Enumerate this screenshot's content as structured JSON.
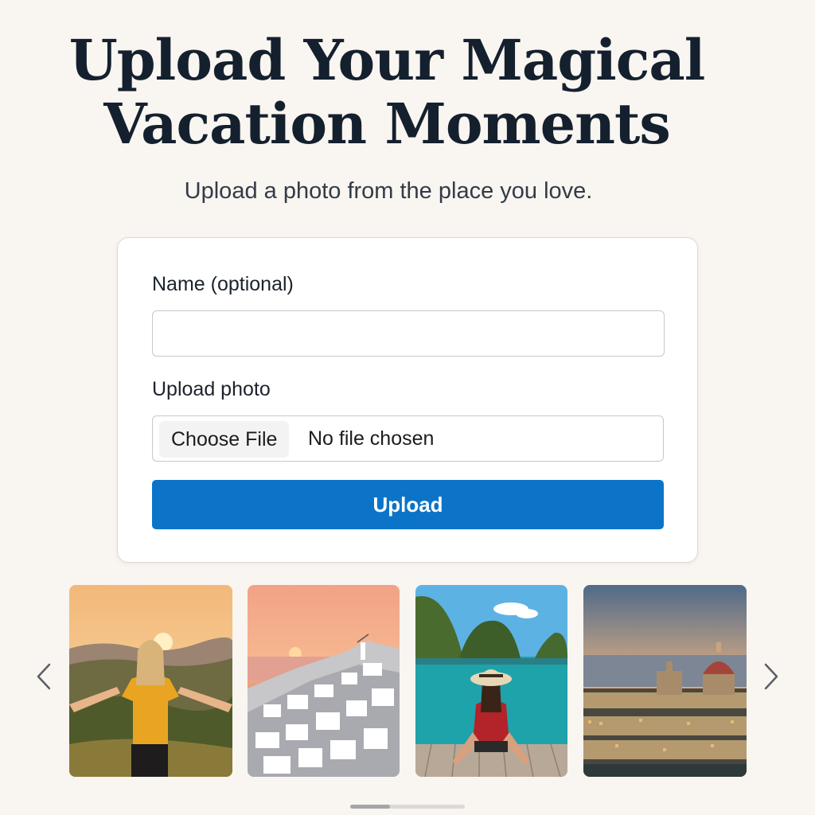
{
  "header": {
    "title_line1": "Upload Your Magical",
    "title_line2": "Vacation Moments",
    "subtitle": "Upload a photo from the place you love."
  },
  "form": {
    "name_label": "Name (optional)",
    "name_value": "",
    "photo_label": "Upload photo",
    "choose_file_label": "Choose File",
    "file_status": "No file chosen",
    "upload_label": "Upload"
  },
  "gallery": {
    "photos": [
      {
        "subject": "woman with open arms at sunset over hills"
      },
      {
        "subject": "white village on cliffs at sunset by the sea"
      },
      {
        "subject": "woman in sun hat on dock facing turquoise bay with karst islands"
      },
      {
        "subject": "city skyline with domed cathedral at dusk"
      }
    ],
    "prev_icon": "chevron-left-icon",
    "next_icon": "chevron-right-icon"
  },
  "colors": {
    "background": "#f9f5f0",
    "accent": "#0b74c9",
    "title": "#14202e"
  }
}
